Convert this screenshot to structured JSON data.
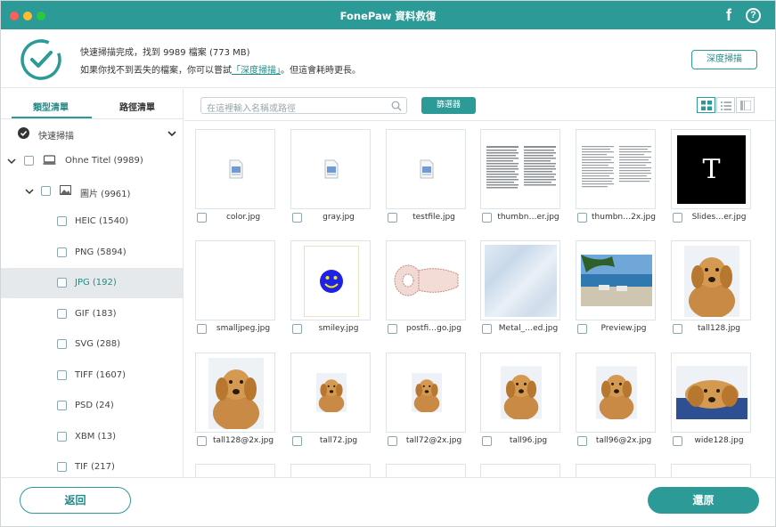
{
  "window": {
    "title": "FonePaw 資料救復"
  },
  "status": {
    "line1": "快速掃描完成，找到 9989 檔案 (773 MB)",
    "line2_before": "如果你找不到丟失的檔案，你可以嘗試",
    "line2_link": "「深度掃描」",
    "line2_after": "。但這會耗時更長。",
    "deep_scan_button": "深度掃描"
  },
  "sidebar": {
    "tabs": [
      "類型清單",
      "路徑清單"
    ],
    "active_tab": "類型清單",
    "quick_scan_label": "快速掃描",
    "tree": [
      {
        "label": "Ohne Titel (9989)",
        "type": "drive"
      },
      {
        "label": "圖片 (9961)",
        "type": "folder"
      },
      {
        "label": "HEIC (1540)",
        "type": "item"
      },
      {
        "label": "PNG (5894)",
        "type": "item"
      },
      {
        "label": "JPG (192)",
        "type": "item",
        "selected": true
      },
      {
        "label": "GIF (183)",
        "type": "item"
      },
      {
        "label": "SVG (288)",
        "type": "item"
      },
      {
        "label": "TIFF (1607)",
        "type": "item"
      },
      {
        "label": "PSD (24)",
        "type": "item"
      },
      {
        "label": "XBM (13)",
        "type": "item"
      },
      {
        "label": "TIF (217)",
        "type": "item"
      }
    ]
  },
  "toolbar": {
    "search_placeholder": "在這裡輸入名稱或路徑",
    "filter_button": "篩選器"
  },
  "files": [
    {
      "name": "color.jpg",
      "thumb": "doc-icon"
    },
    {
      "name": "gray.jpg",
      "thumb": "doc-icon"
    },
    {
      "name": "testfile.jpg",
      "thumb": "doc-icon"
    },
    {
      "name": "thumbn…er.jpg",
      "thumb": "text-page"
    },
    {
      "name": "thumbn…2x.jpg",
      "thumb": "text-page"
    },
    {
      "name": "Slides…er.jpg",
      "thumb": "black-T"
    },
    {
      "name": "smalljpeg.jpg",
      "thumb": "blank"
    },
    {
      "name": "smiley.jpg",
      "thumb": "smiley"
    },
    {
      "name": "postfi…go.jpg",
      "thumb": "postfix-logo"
    },
    {
      "name": "Metal_…ed.jpg",
      "thumb": "texture"
    },
    {
      "name": "Preview.jpg",
      "thumb": "beach"
    },
    {
      "name": "tall128.jpg",
      "thumb": "dog"
    },
    {
      "name": "tall128@2x.jpg",
      "thumb": "dog"
    },
    {
      "name": "tall72.jpg",
      "thumb": "dog-small"
    },
    {
      "name": "tall72@2x.jpg",
      "thumb": "dog-small"
    },
    {
      "name": "tall96.jpg",
      "thumb": "dog-medium"
    },
    {
      "name": "tall96@2x.jpg",
      "thumb": "dog-medium"
    },
    {
      "name": "wide128.jpg",
      "thumb": "dog-wide"
    },
    {
      "name": "",
      "thumb": "blank"
    },
    {
      "name": "",
      "thumb": "blank"
    },
    {
      "name": "",
      "thumb": "blank"
    },
    {
      "name": "",
      "thumb": "blank"
    },
    {
      "name": "",
      "thumb": "blank"
    },
    {
      "name": "",
      "thumb": "blank"
    }
  ],
  "footer": {
    "back_button": "返回",
    "restore_button": "還原"
  },
  "colors": {
    "accent": "#2c9a97",
    "selected_row": "#e6e9eb"
  },
  "icons": [
    "facebook-icon",
    "help-icon",
    "check-circle-icon",
    "search-icon",
    "grid-view-icon",
    "list-view-icon",
    "detail-view-icon",
    "chevron-down-icon",
    "drive-icon",
    "image-icon"
  ]
}
